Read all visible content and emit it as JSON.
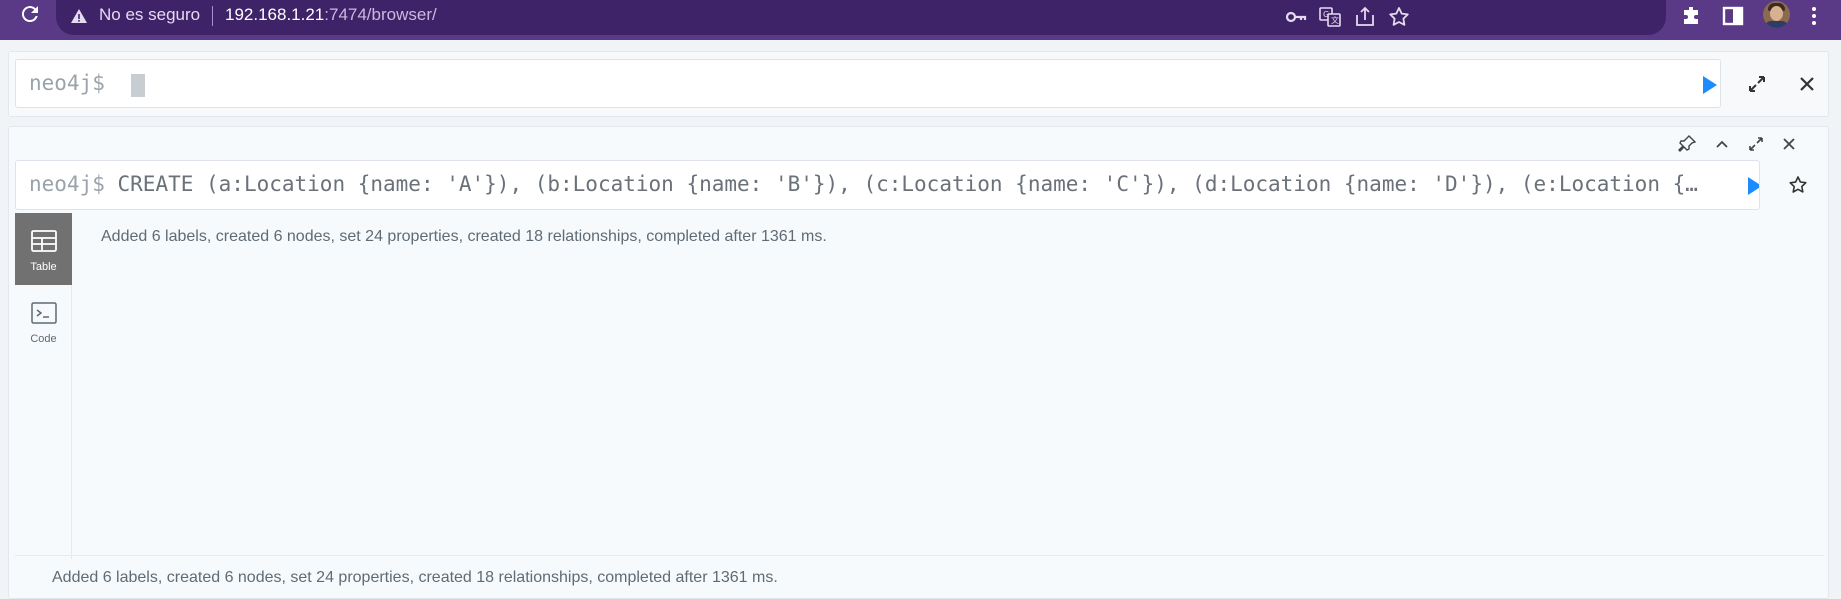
{
  "browser": {
    "security_label": "No es seguro",
    "url_host": "192.168.1.21",
    "url_rest": ":7474/browser/",
    "accent": "#5a3987",
    "icons": [
      "reload-icon",
      "warning-icon",
      "key-icon",
      "translate-icon",
      "share-icon",
      "star-icon",
      "extensions-icon",
      "sidepanel-icon",
      "menu-icon"
    ]
  },
  "editor": {
    "prompt": "neo4j$",
    "value": ""
  },
  "result": {
    "prompt": "neo4j$",
    "query": "CREATE (a:Location {name: 'A'}), (b:Location {name: 'B'}), (c:Location {name: 'C'}), (d:Location {name: 'D'}), (e:Location {…",
    "tabs": [
      {
        "label": "Table",
        "active": true
      },
      {
        "label": "Code",
        "active": false
      }
    ],
    "summary": "Added 6 labels, created 6 nodes, set 24 properties, created 18 relationships, completed after 1361 ms.",
    "footer_summary": "Added 6 labels, created 6 nodes, set 24 properties, created 18 relationships, completed after 1361 ms."
  },
  "colors": {
    "run_button": "#1a8cff",
    "tab_active_bg": "#717171"
  }
}
